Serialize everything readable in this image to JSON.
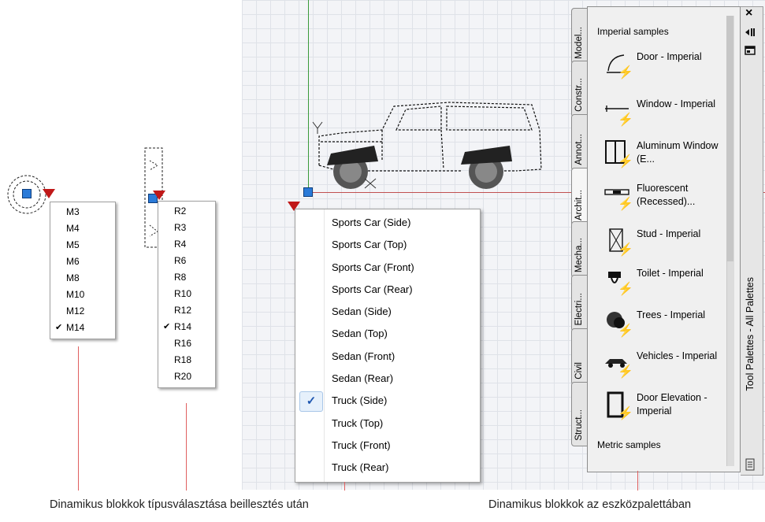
{
  "bolt_size_menu": {
    "items": [
      "M3",
      "M4",
      "M5",
      "M6",
      "M8",
      "M10",
      "M12",
      "M14"
    ],
    "checked": "M14"
  },
  "radius_menu": {
    "items": [
      "R2",
      "R3",
      "R4",
      "R6",
      "R8",
      "R10",
      "R12",
      "R14",
      "R16",
      "R18",
      "R20"
    ],
    "checked": "R14"
  },
  "vehicle_menu": {
    "items": [
      "Sports Car (Side)",
      "Sports Car (Top)",
      "Sports Car (Front)",
      "Sports Car (Rear)",
      "Sedan (Side)",
      "Sedan (Top)",
      "Sedan (Front)",
      "Sedan (Rear)",
      "Truck (Side)",
      "Truck (Top)",
      "Truck (Front)",
      "Truck (Rear)"
    ],
    "checked": "Truck (Side)"
  },
  "palette": {
    "title": "Tool Palettes - All Palettes",
    "tabs": [
      "Model...",
      "Constr...",
      "Annot...",
      "Archit...",
      "Mecha...",
      "Electri...",
      "Civil",
      "Struct..."
    ],
    "active_tab": "Archit...",
    "section_imperial": "Imperial samples",
    "section_metric": "Metric samples",
    "items": [
      {
        "label": "Door - Imperial",
        "icon": "door-icon"
      },
      {
        "label": "Window - Imperial",
        "icon": "window-icon"
      },
      {
        "label": "Aluminum Window (E...",
        "icon": "aluminum-window-icon"
      },
      {
        "label": "Fluorescent (Recessed)...",
        "icon": "fluorescent-icon"
      },
      {
        "label": "Stud - Imperial",
        "icon": "stud-icon"
      },
      {
        "label": "Toilet - Imperial",
        "icon": "toilet-icon"
      },
      {
        "label": "Trees - Imperial",
        "icon": "trees-icon"
      },
      {
        "label": "Vehicles - Imperial",
        "icon": "vehicles-icon"
      },
      {
        "label": "Door Elevation - Imperial",
        "icon": "door-elevation-icon"
      }
    ],
    "close_glyph": "×"
  },
  "captions": {
    "left": "Dinamikus blokkok  típusválasztása beillesztés után",
    "right": "Dinamikus blokkok az eszközpalettában"
  },
  "colors": {
    "grip_red": "#c01818",
    "grip_blue": "#2a7ad8",
    "check_blue": "#1f57b0"
  }
}
